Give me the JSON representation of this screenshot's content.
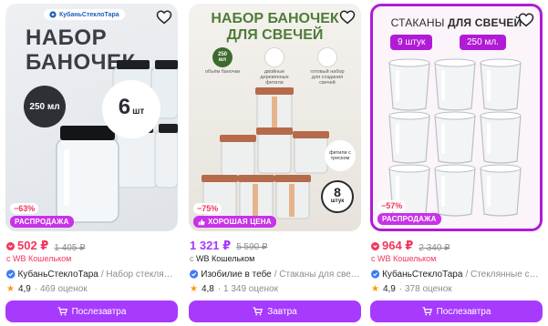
{
  "cards": [
    {
      "discount": "−63%",
      "badge": "РАСПРОДАЖА",
      "price": "502 ₽",
      "old_price": "1 405 ₽",
      "wallet_prefix": "с",
      "wallet_name": "WB Кошельком",
      "brand": "КубаньСтеклоТара",
      "name": "/ Набор стеклянн...",
      "rating": "4,9",
      "reviews": "· 469 оценок",
      "button": "Послезавтра",
      "art": {
        "logo": "КубаньСтеклоТара",
        "title_line1": "НАБОР",
        "title_line2": "БАНОЧЕК",
        "volume": "250 мл",
        "count": "6",
        "count_unit": "шт"
      }
    },
    {
      "discount": "−75%",
      "badge": "ХОРОШАЯ ЦЕНА",
      "price": "1 321 ₽",
      "old_price": "5 590 ₽",
      "wallet_prefix": "с",
      "wallet_name": "WB Кошельком",
      "brand": "Изобилие в тебе",
      "name": "/ Стаканы для свече...",
      "rating": "4,8",
      "reviews": "· 1 349 оценок",
      "button": "Завтра",
      "art": {
        "title_line1": "НАБОР БАНОЧЕК",
        "title_line2": "ДЛЯ СВЕЧЕЙ",
        "volume_n": "250",
        "volume_u": "мл",
        "feat1": "объём баночки",
        "feat2": "двойные деревянные фитили",
        "feat3": "готовый набор для создания свечей",
        "wick": "фитили с треском",
        "count": "8",
        "count_unit": "штук"
      }
    },
    {
      "discount": "−57%",
      "badge": "РАСПРОДАЖА",
      "price": "964 ₽",
      "old_price": "2 340 ₽",
      "wallet_prefix": "с",
      "wallet_name": "WB Кошельком",
      "brand": "КубаньСтеклоТара",
      "name": "/ Стеклянные стак...",
      "rating": "4,9",
      "reviews": "· 378 оценок",
      "button": "Послезавтра",
      "art": {
        "title_regular": "СТАКАНЫ ",
        "title_bold": "ДЛЯ СВЕЧЕЙ",
        "pill1": "9 штук",
        "pill2": "250 мл."
      }
    }
  ],
  "colors": {
    "accent": "#a73afd",
    "price_red": "#f2355b",
    "badge": "#c832e8",
    "frame": "#b11bd6"
  }
}
